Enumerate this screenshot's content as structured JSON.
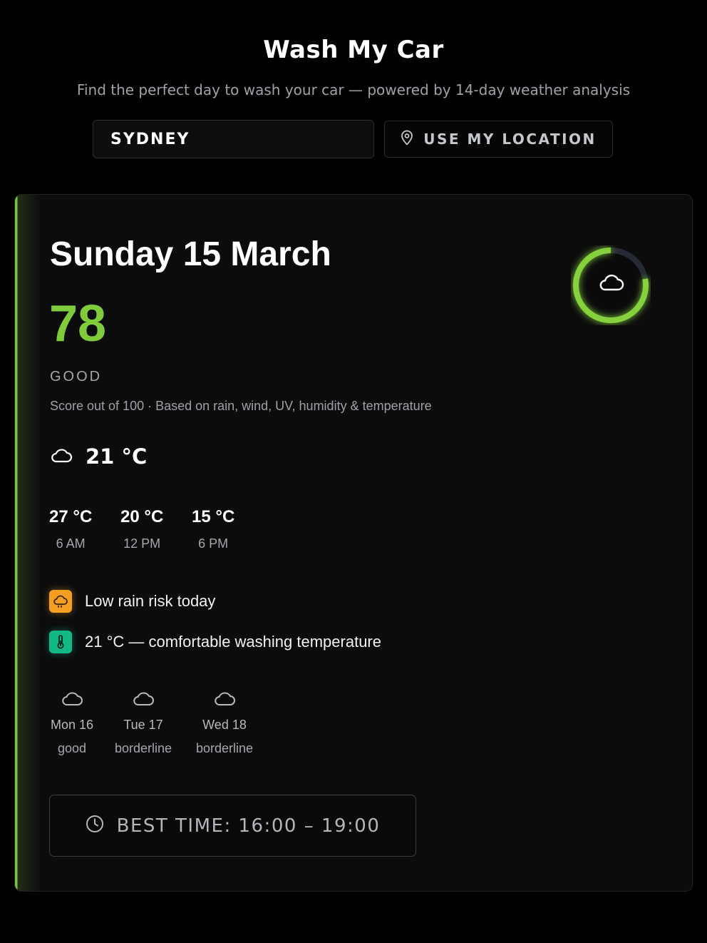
{
  "header": {
    "title": "Wash My Car",
    "subtitle": "Find the perfect day to wash your car — powered by 14-day weather analysis"
  },
  "search": {
    "value": "SYDNEY",
    "location_button_label": "USE MY LOCATION",
    "location_icon": "map-pin-icon"
  },
  "today": {
    "date": "Sunday 15 March",
    "score": "78",
    "score_fraction": 0.78,
    "rating": "GOOD",
    "score_note": "Score out of 100 · Based on rain, wind, UV, humidity & temperature",
    "weather_icon": "cloud-icon",
    "current_temp": "21 °C",
    "hourly": [
      {
        "temp": "27 °C",
        "time": "6 AM"
      },
      {
        "temp": "20 °C",
        "time": "12 PM"
      },
      {
        "temp": "15 °C",
        "time": "6 PM"
      }
    ],
    "tips": [
      {
        "icon": "rain-cloud-icon",
        "color": "#f59f22",
        "text": "Low rain risk today"
      },
      {
        "icon": "thermometer-icon",
        "color": "#12b886",
        "text": "21 °C — comfortable washing temperature"
      }
    ],
    "forecast": [
      {
        "icon": "cloud-icon",
        "day": "Mon 16",
        "status": "good"
      },
      {
        "icon": "cloud-icon",
        "day": "Tue 17",
        "status": "borderline"
      },
      {
        "icon": "cloud-icon",
        "day": "Wed 18",
        "status": "borderline"
      }
    ],
    "best_time": "BEST TIME: 16:00 – 19:00"
  },
  "colors": {
    "accent": "#80cb3b",
    "background": "#000000",
    "card": "#0c0c0d"
  }
}
